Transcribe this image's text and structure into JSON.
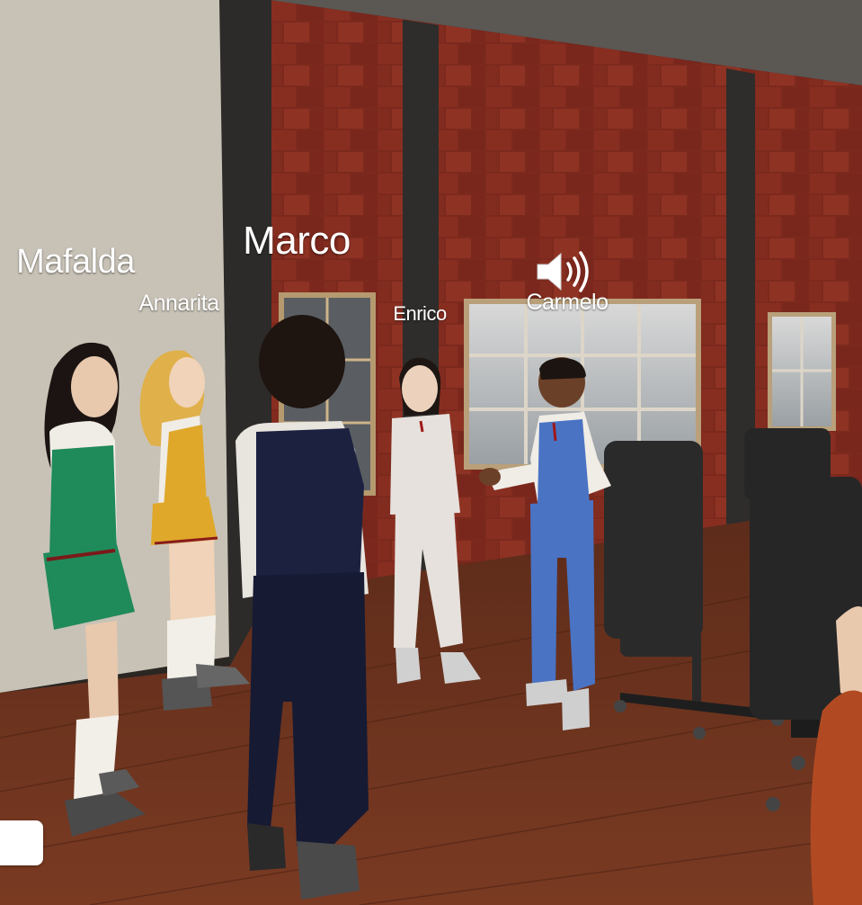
{
  "scene": {
    "type": "3D virtual meeting room",
    "avatars": [
      {
        "name": "Mafalda",
        "outfit_color": "#1f8a5a"
      },
      {
        "name": "Annarita",
        "outfit_color": "#e0a82a"
      },
      {
        "name": "Marco",
        "outfit_color": "#1c2140"
      },
      {
        "name": "Enrico",
        "outfit_color": "#e6e1dc"
      },
      {
        "name": "Carmelo",
        "outfit_color": "#4a73c4",
        "speaking": true
      }
    ],
    "speaking_indicator_icon": "speaker-volume-icon",
    "colors": {
      "brick_wall": "#8a2e22",
      "left_wall": "#c9c3b8",
      "wooden_floor": "#6a3320",
      "nametag_text": "#ffffff"
    }
  },
  "ui": {
    "chat_input": {
      "value": "",
      "placeholder": ""
    }
  }
}
